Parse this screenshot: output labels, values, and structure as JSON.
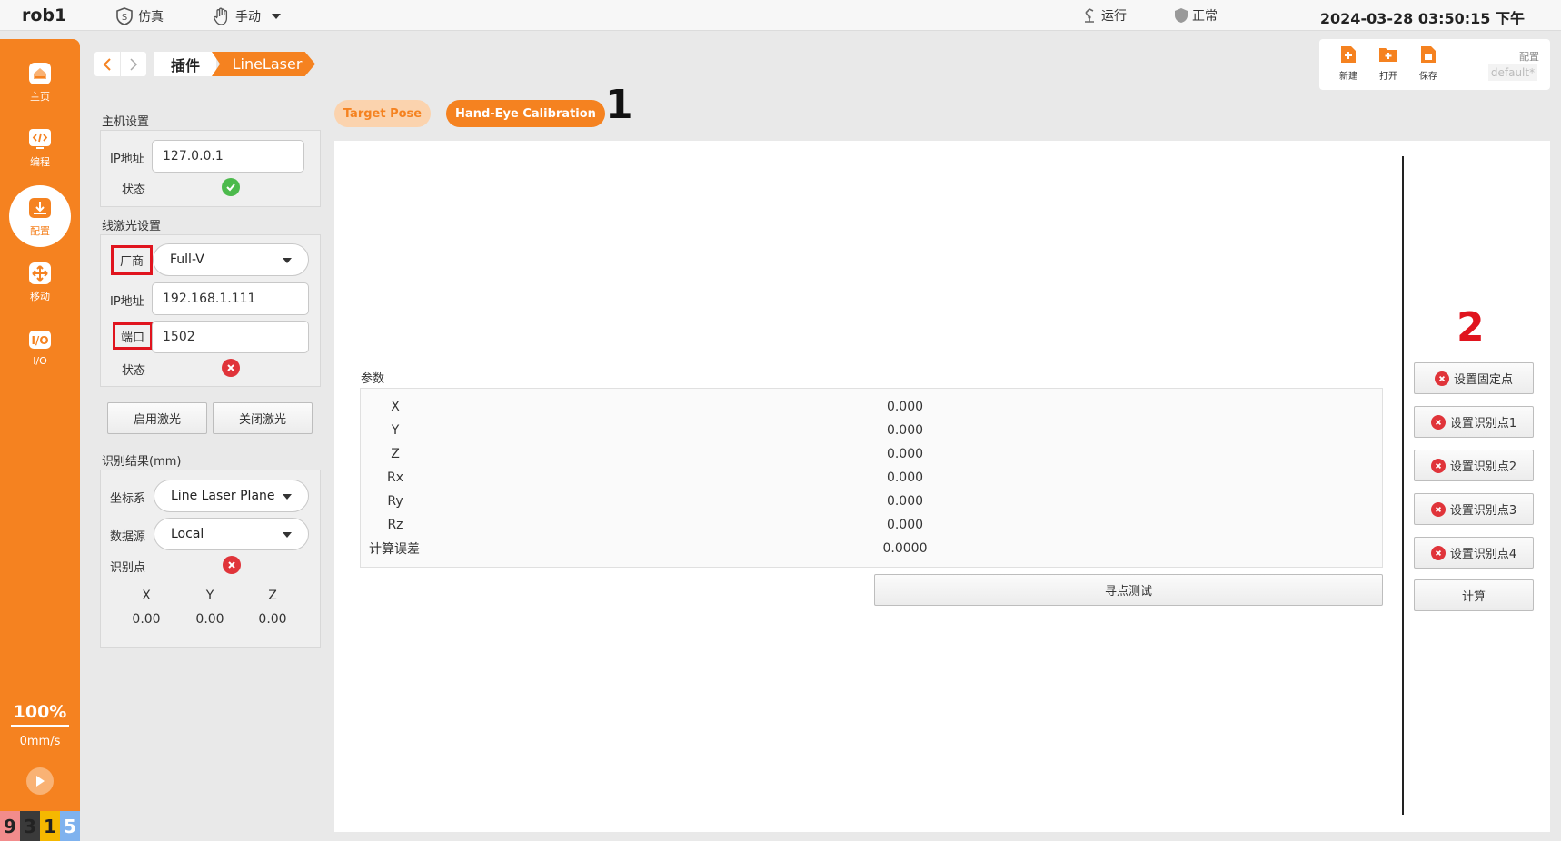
{
  "topbar": {
    "robot_name": "rob1",
    "mode_sim": "仿真",
    "mode_manual": "手动",
    "state_run": "运行",
    "state_normal": "正常",
    "datetime": "2024-03-28 03:50:15 下午"
  },
  "sidebar": {
    "items": [
      {
        "label": "主页",
        "icon": "home-icon"
      },
      {
        "label": "编程",
        "icon": "code-icon"
      },
      {
        "label": "配置",
        "icon": "config-icon"
      },
      {
        "label": "移动",
        "icon": "move-icon"
      },
      {
        "label": "I/O",
        "icon": "io-icon"
      }
    ],
    "speed_percent": "100%",
    "speed_mms": "0mm/s",
    "bottom_numbers": [
      "9",
      "3",
      "1",
      "5"
    ],
    "bottom_colors": [
      "#f28c8c",
      "#3a3a3a",
      "#f5b800",
      "#7fb2ee"
    ]
  },
  "breadcrumb": {
    "plugin": "插件",
    "current": "LineLaser"
  },
  "config_widget": {
    "new_label": "新建",
    "open_label": "打开",
    "save_label": "保存",
    "config_label": "配置",
    "config_value": "default*"
  },
  "host_settings": {
    "title": "主机设置",
    "ip_label": "IP地址",
    "ip_value": "127.0.0.1",
    "status_label": "状态",
    "status": "ok"
  },
  "laser_settings": {
    "title": "线激光设置",
    "vendor_label": "厂商",
    "vendor_value": "Full-V",
    "ip_label": "IP地址",
    "ip_value": "192.168.1.111",
    "port_label": "端口",
    "port_value": "1502",
    "status_label": "状态",
    "status": "error",
    "enable_btn": "启用激光",
    "disable_btn": "关闭激光"
  },
  "recognition": {
    "title": "识别结果(mm)",
    "coord_label": "坐标系",
    "coord_value": "Line Laser Plane",
    "source_label": "数据源",
    "source_value": "Local",
    "point_label": "识别点",
    "point_status": "error",
    "headers": [
      "X",
      "Y",
      "Z"
    ],
    "values": [
      "0.00",
      "0.00",
      "0.00"
    ]
  },
  "tabs": {
    "target_pose": "Target Pose",
    "hand_eye": "Hand-Eye Calibration",
    "active": "Hand-Eye Calibration"
  },
  "annotations": {
    "marker_1": "1",
    "marker_2": "2"
  },
  "params": {
    "title": "参数",
    "rows": [
      {
        "label": "X",
        "value": "0.000"
      },
      {
        "label": "Y",
        "value": "0.000"
      },
      {
        "label": "Z",
        "value": "0.000"
      },
      {
        "label": "Rx",
        "value": "0.000"
      },
      {
        "label": "Ry",
        "value": "0.000"
      },
      {
        "label": "Rz",
        "value": "0.000"
      },
      {
        "label": "计算误差",
        "value": "0.0000"
      }
    ],
    "probe_btn": "寻点测试"
  },
  "calib_buttons": {
    "fixed_point": "设置固定点",
    "point1": "设置识别点1",
    "point2": "设置识别点2",
    "point3": "设置识别点3",
    "point4": "设置识别点4",
    "compute": "计算"
  },
  "colors": {
    "accent": "#f58220",
    "ok": "#4cba4c",
    "error": "#e0343a",
    "highlight": "#e0141e"
  }
}
